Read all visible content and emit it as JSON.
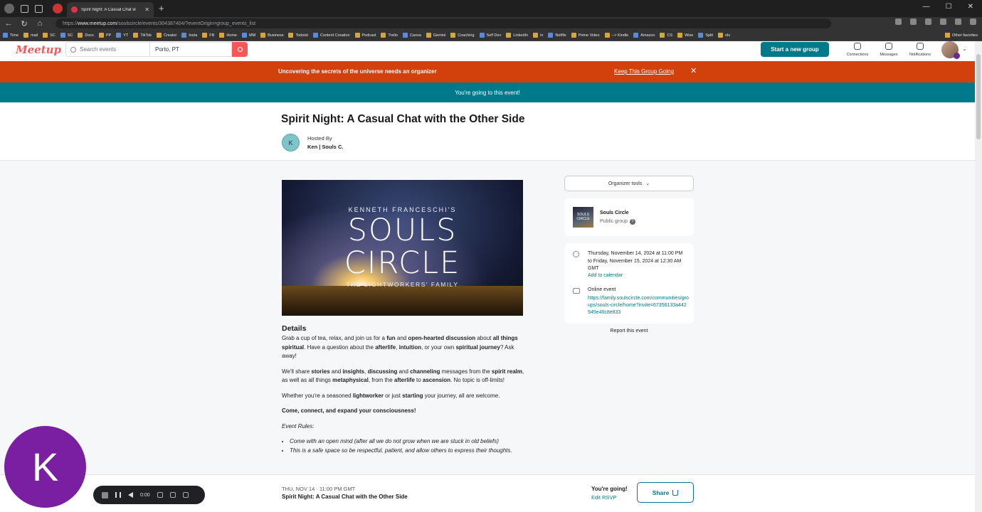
{
  "browser": {
    "tab_title": "Spirit Night: A Casual Chat w",
    "url_prefix": "https://",
    "url_host": "www.meetup.com",
    "url_path": "/soulscircle/events/304387404/?eventOrigin=group_events_list",
    "bookmarks": [
      "Time",
      "mail",
      "SC",
      "SC",
      "Docs",
      "PP",
      "YT",
      "TikTok",
      "Creator",
      "Insta",
      "FB",
      "Home",
      "MM",
      "Business",
      "Todoist",
      "Content Creation",
      "Podcast",
      "Trello",
      "Canva",
      "Gemini",
      "Coaching",
      "Self Dev",
      "LinkedIn",
      "in",
      "Netflix",
      "Prime Video",
      "--> Kindle",
      "Amazon",
      "CS",
      "Wise",
      "Split",
      "olx"
    ],
    "other_favorites": "Other favorites"
  },
  "header": {
    "logo": "Meetup",
    "search_placeholder": "Search events",
    "location_value": "Porto, PT",
    "start_group": "Start a new group",
    "connections": "Connections",
    "messages": "Messages",
    "notifications": "Notifications"
  },
  "banners": {
    "organizer_msg": "Uncovering the secrets of the universe needs an organizer",
    "organizer_link": "Keep This Group Going",
    "close": "✕",
    "going_msg": "You're going to this event!"
  },
  "event": {
    "title": "Spirit Night: A Casual Chat with the Other Side",
    "host_initial": "K",
    "hosted_by": "Hosted By",
    "host_name": "Ken | Souls C."
  },
  "hero": {
    "line1": "KENNETH FRANCESCHI'S",
    "line2": "SOULS",
    "line3": "CIRCLE",
    "line4": "THE LIGHTWORKERS' FAMILY"
  },
  "details": {
    "heading": "Details",
    "p1": [
      {
        "t": "Grab a cup of tea, relax, and join us for a "
      },
      {
        "t": "fun",
        "b": true
      },
      {
        "t": " and "
      },
      {
        "t": "open-hearted discussion",
        "b": true
      },
      {
        "t": " about "
      },
      {
        "t": "all things spiritual",
        "b": true
      },
      {
        "t": ". Have a question about the "
      },
      {
        "t": "afterlife",
        "b": true
      },
      {
        "t": ", "
      },
      {
        "t": "intuition",
        "b": true
      },
      {
        "t": ", or your own "
      },
      {
        "t": "spiritual journey",
        "b": true
      },
      {
        "t": "? Ask away!"
      }
    ],
    "p2": [
      {
        "t": "We'll share "
      },
      {
        "t": "stories",
        "b": true
      },
      {
        "t": " and "
      },
      {
        "t": "insights",
        "b": true
      },
      {
        "t": ", "
      },
      {
        "t": "discussing",
        "b": true
      },
      {
        "t": " and "
      },
      {
        "t": "channeling",
        "b": true
      },
      {
        "t": " messages from the "
      },
      {
        "t": "spirit realm",
        "b": true
      },
      {
        "t": ", as well as all things "
      },
      {
        "t": "metaphysical",
        "b": true
      },
      {
        "t": ", from the "
      },
      {
        "t": "afterlife",
        "b": true
      },
      {
        "t": " to "
      },
      {
        "t": "ascension",
        "b": true
      },
      {
        "t": ". No topic is off-limits!"
      }
    ],
    "p3": [
      {
        "t": "Whether you're a seasoned "
      },
      {
        "t": "lightworker",
        "b": true
      },
      {
        "t": " or just "
      },
      {
        "t": "starting",
        "b": true
      },
      {
        "t": " your journey, all are welcome."
      }
    ],
    "p4": "Come, connect, and expand your consciousness!",
    "rules_heading": "Event Rules:",
    "rules": [
      "Come with an open mind (after all we do not grow when we are stuck in old beliefs)",
      "This is a safe space so be respectful, patient, and allow others to express their thoughts."
    ]
  },
  "sidebar": {
    "organizer_tools": "Organizer tools",
    "group_thumb": "SOULS CIRCLE",
    "group_name": "Souls Circle",
    "group_type": "Public group",
    "help": "?",
    "time": "Thursday, November 14, 2024 at 11:00 PM to Friday, November 15, 2024 at 12:30 AM GMT",
    "add_calendar": "Add to calendar",
    "online_label": "Online event",
    "online_link": "https://family.soulscircle.com/communities/groups/souls-circle/home?invite=67356133a442945e40c8e833",
    "report": "Report this event"
  },
  "footer": {
    "date": "THU, NOV 14 · 11:00 PM GMT",
    "title": "Spirit Night: A Casual Chat with the Other Side",
    "going": "You're going!",
    "edit_rsvp": "Edit RSVP",
    "share": "Share"
  },
  "overlay": {
    "cam_initial": "K",
    "rec_time": "0:00"
  }
}
